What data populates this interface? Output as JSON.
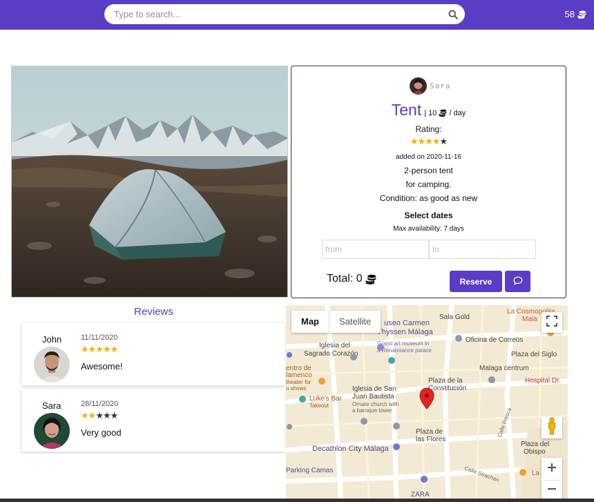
{
  "header": {
    "search_placeholder": "Type to search...",
    "coin_balance": "58"
  },
  "listing": {
    "owner_name": "Sara",
    "title": "Tent",
    "price_prefix": "| 10",
    "price_suffix": "/ day",
    "rating_label": "Rating:",
    "rating": 4,
    "rating_max": 5,
    "added_on": "added on 2020-11-16",
    "description_lines": [
      "2-person tent",
      "for camping.",
      "Condition: as good as new"
    ],
    "select_dates_label": "Select dates",
    "max_availability": "Max availability: 7 days",
    "from_placeholder": "from",
    "to_placeholder": "to",
    "total_label": "Total: 0",
    "reserve_label": "Reserve"
  },
  "reviews": {
    "title": "Reviews",
    "items": [
      {
        "name": "John",
        "date": "11/11/2020",
        "rating": 5,
        "text": "Awesome!"
      },
      {
        "name": "Sara",
        "date": "28/11/2020",
        "rating": 2,
        "text": "Very good"
      }
    ]
  },
  "map": {
    "map_label": "Map",
    "satellite_label": "Satellite",
    "labels": {
      "museo": "useo Carmen",
      "thyssen": "Thyssen Málaga",
      "museo_sub1": "Grand art museum in",
      "museo_sub2": "a Renaissance palace",
      "iglesia1": "Iglesia del",
      "iglesia1b": "Sagrado Corazón",
      "sala_gold": "Sala Gold",
      "cosmopolita": "La Cosmopolita",
      "cosmopolita_b": "Mala",
      "oficina": "Oficina de Correos",
      "plaza_siglo": "Plaza del Siglo",
      "centro1": "entro de",
      "centro2": "lamenco",
      "centro3": "theater for",
      "centro4": "o shows",
      "malaga_centrum": "Malaga centrum",
      "hospital": "Hospital Dr.",
      "plaza_const1": "Plaza de la",
      "plaza_const2": "Constitución",
      "iglesia2": "Iglesia de San",
      "iglesia2b": "Juan Bautista",
      "iglesia2c": "Ornate church with",
      "iglesia2d": "a baroque tower",
      "lukes1": "Luke's Bar",
      "lukes2": "Takeout",
      "calle_fresca": "Calle Fresca",
      "plaza_flores1": "Plaza de",
      "plaza_flores2": "las Flores",
      "plaza_obispo1": "Plaza del",
      "plaza_obispo2": "Obispo",
      "decathlon": "Decathlon City Málaga",
      "parking": "Parking Camas",
      "calle_strachan": "Calle Strachan",
      "la_tra": "La Tra",
      "zara": "ZARA"
    }
  },
  "colors": {
    "brand": "#5b3cc4",
    "star": "#f3b10e"
  }
}
